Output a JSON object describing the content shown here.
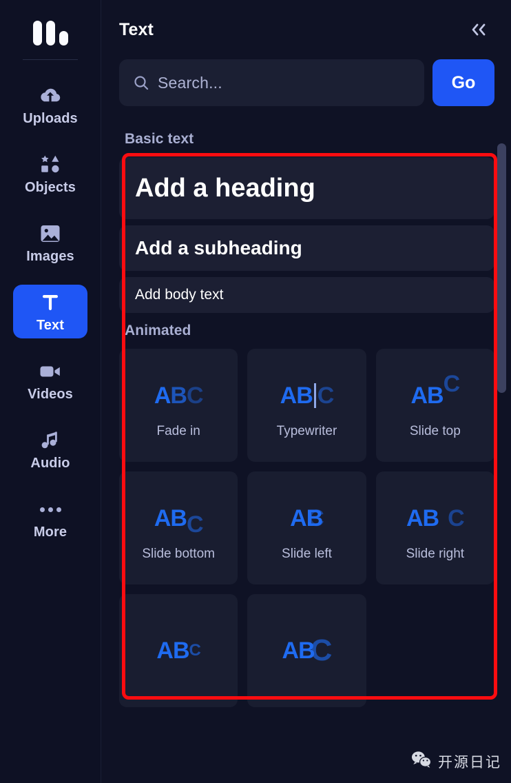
{
  "app": {
    "logo_name": "app-logo"
  },
  "sidebar": {
    "items": [
      {
        "label": "Uploads",
        "icon": "cloud-upload-icon",
        "active": false
      },
      {
        "label": "Objects",
        "icon": "shapes-icon",
        "active": false
      },
      {
        "label": "Images",
        "icon": "image-icon",
        "active": false
      },
      {
        "label": "Text",
        "icon": "text-t-icon",
        "active": true
      },
      {
        "label": "Videos",
        "icon": "video-camera-icon",
        "active": false
      },
      {
        "label": "Audio",
        "icon": "music-note-icon",
        "active": false
      },
      {
        "label": "More",
        "icon": "ellipsis-icon",
        "active": false
      }
    ]
  },
  "panel": {
    "title": "Text",
    "collapse_icon": "double-chevron-left-icon"
  },
  "search": {
    "placeholder": "Search...",
    "value": "",
    "icon": "search-icon",
    "go_label": "Go"
  },
  "sections": {
    "basic": {
      "label": "Basic text",
      "items": [
        {
          "label": "Add a heading",
          "style": "heading"
        },
        {
          "label": "Add a subheading",
          "style": "subheading"
        },
        {
          "label": "Add body text",
          "style": "body"
        }
      ]
    },
    "animated": {
      "label": "Animated",
      "items": [
        {
          "label": "Fade in",
          "preview": "ABC",
          "fx": "fx-fade"
        },
        {
          "label": "Typewriter",
          "preview": "ABC",
          "fx": "fx-type"
        },
        {
          "label": "Slide top",
          "preview": "ABC",
          "fx": "fx-stop"
        },
        {
          "label": "Slide bottom",
          "preview": "ABC",
          "fx": "fx-sbot"
        },
        {
          "label": "Slide left",
          "preview": "ABC",
          "fx": "fx-slft"
        },
        {
          "label": "Slide right",
          "preview": "ABC",
          "fx": "fx-srgt"
        },
        {
          "label": "",
          "preview": "ABC",
          "fx": "fx-small"
        },
        {
          "label": "",
          "preview": "ABC",
          "fx": "fx-big"
        }
      ]
    }
  },
  "watermark": {
    "text": "开源日记",
    "icon": "wechat-icon"
  },
  "colors": {
    "accent_blue": "#1f56f5",
    "preview_blue": "#1f6bf0",
    "annotation_red": "#fb0c10",
    "panel_bg": "#0f1225",
    "sidebar_bg": "#0e1124",
    "card_bg": "#1c1f33"
  }
}
